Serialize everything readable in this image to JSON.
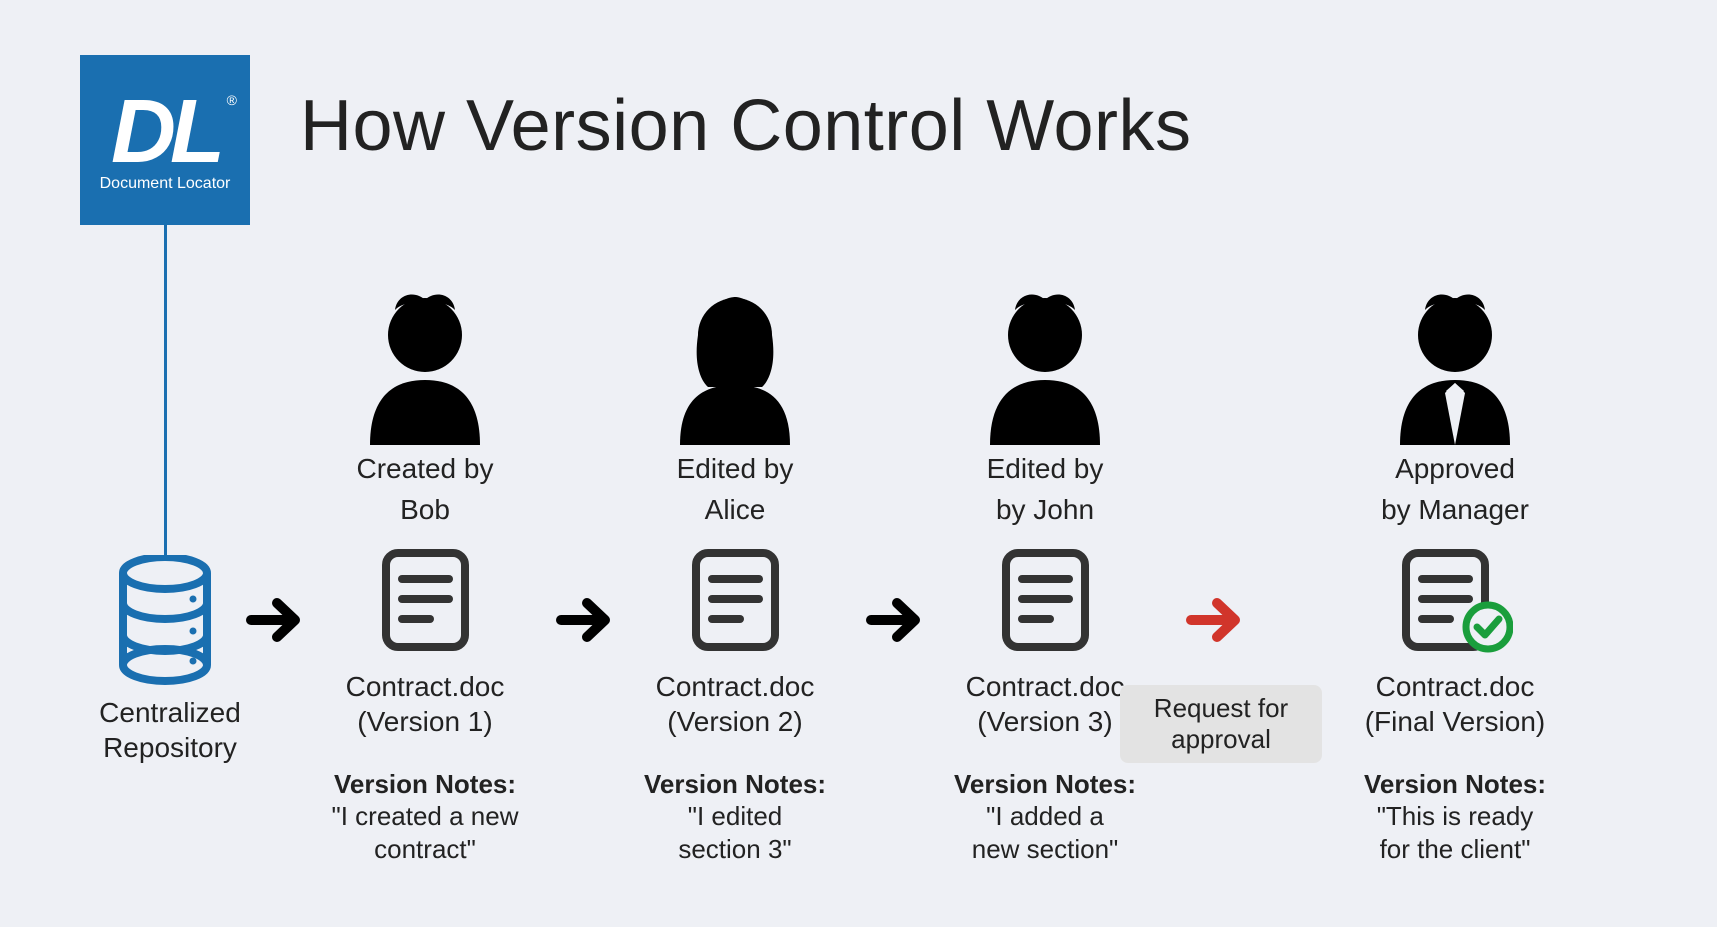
{
  "logo": {
    "letters": "DL",
    "reg": "®",
    "sub": "Document Locator"
  },
  "title": "How Version Control Works",
  "repo_label_1": "Centralized",
  "repo_label_2": "Repository",
  "request_label_1": "Request for",
  "request_label_2": "approval",
  "stages": [
    {
      "author_line1": "Created by",
      "author_line2": "Bob",
      "file": "Contract.doc",
      "version": "(Version 1)",
      "notes_head": "Version Notes:",
      "notes_line1": "\"I created a new",
      "notes_line2": "contract\""
    },
    {
      "author_line1": "Edited by",
      "author_line2": "Alice",
      "file": "Contract.doc",
      "version": "(Version 2)",
      "notes_head": "Version Notes:",
      "notes_line1": "\"I edited",
      "notes_line2": "section 3\""
    },
    {
      "author_line1": "Edited by",
      "author_line2": "by John",
      "file": "Contract.doc",
      "version": "(Version 3)",
      "notes_head": "Version Notes:",
      "notes_line1": "\"I added a",
      "notes_line2": "new section\""
    },
    {
      "author_line1": "Approved",
      "author_line2": "by Manager",
      "file": "Contract.doc",
      "version": "(Final Version)",
      "notes_head": "Version Notes:",
      "notes_line1": "\"This is ready",
      "notes_line2": "for the client\""
    }
  ]
}
